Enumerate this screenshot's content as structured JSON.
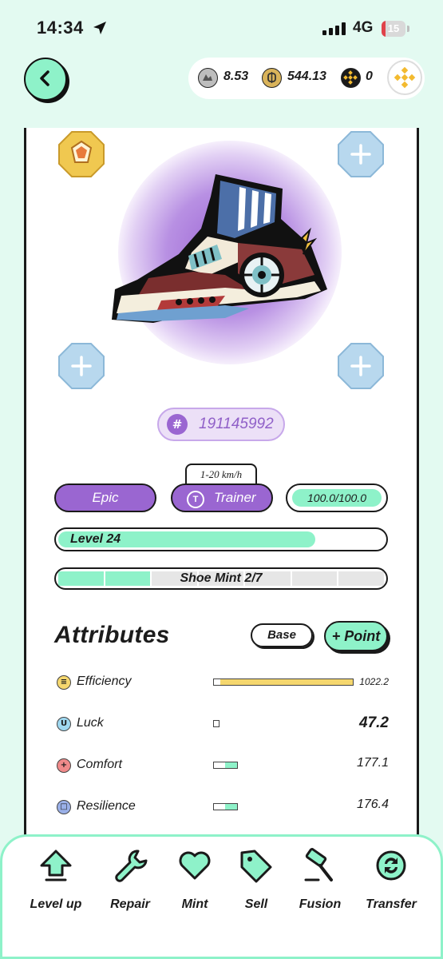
{
  "status_bar": {
    "time": "14:34",
    "network": "4G",
    "battery": "15"
  },
  "wallet": {
    "gst": "8.53",
    "gmt": "544.13",
    "bnb": "0"
  },
  "shoe": {
    "id_hash": "#",
    "id": "191145992",
    "speed_range": "1-20 km/h",
    "rarity": "Epic",
    "type_icon": "T",
    "type": "Trainer",
    "durability": "100.0/100.0",
    "level_label": "Level 24",
    "level_progress": 0.79,
    "mint_label": "Shoe Mint 2/7",
    "mint_used": 2,
    "mint_total": 7
  },
  "attributes": {
    "title": "Attributes",
    "base_label": "Base",
    "point_label": "+ Point",
    "items": [
      {
        "name": "Efficiency",
        "value": "1022.2",
        "fill": 0.97,
        "color": "#f5d76e",
        "icon": "efficiency-icon"
      },
      {
        "name": "Luck",
        "value": "47.2",
        "fill": 0,
        "color": "#8ef2c9",
        "icon": "luck-icon"
      },
      {
        "name": "Comfort",
        "value": "177.1",
        "fill": 0.55,
        "color": "#8ef2c9",
        "icon": "comfort-icon"
      },
      {
        "name": "Resilience",
        "value": "176.4",
        "fill": 0.55,
        "color": "#8ef2c9",
        "icon": "resilience-icon"
      }
    ]
  },
  "nav": [
    {
      "label": "Level up",
      "icon": "level-up-icon"
    },
    {
      "label": "Repair",
      "icon": "repair-icon"
    },
    {
      "label": "Mint",
      "icon": "mint-icon"
    },
    {
      "label": "Sell",
      "icon": "sell-icon"
    },
    {
      "label": "Fusion",
      "icon": "fusion-icon"
    },
    {
      "label": "Transfer",
      "icon": "transfer-icon"
    }
  ],
  "colors": {
    "accent_mint": "#8ef2c9",
    "epic_purple": "#9a66d1",
    "background": "#e3faf1"
  }
}
